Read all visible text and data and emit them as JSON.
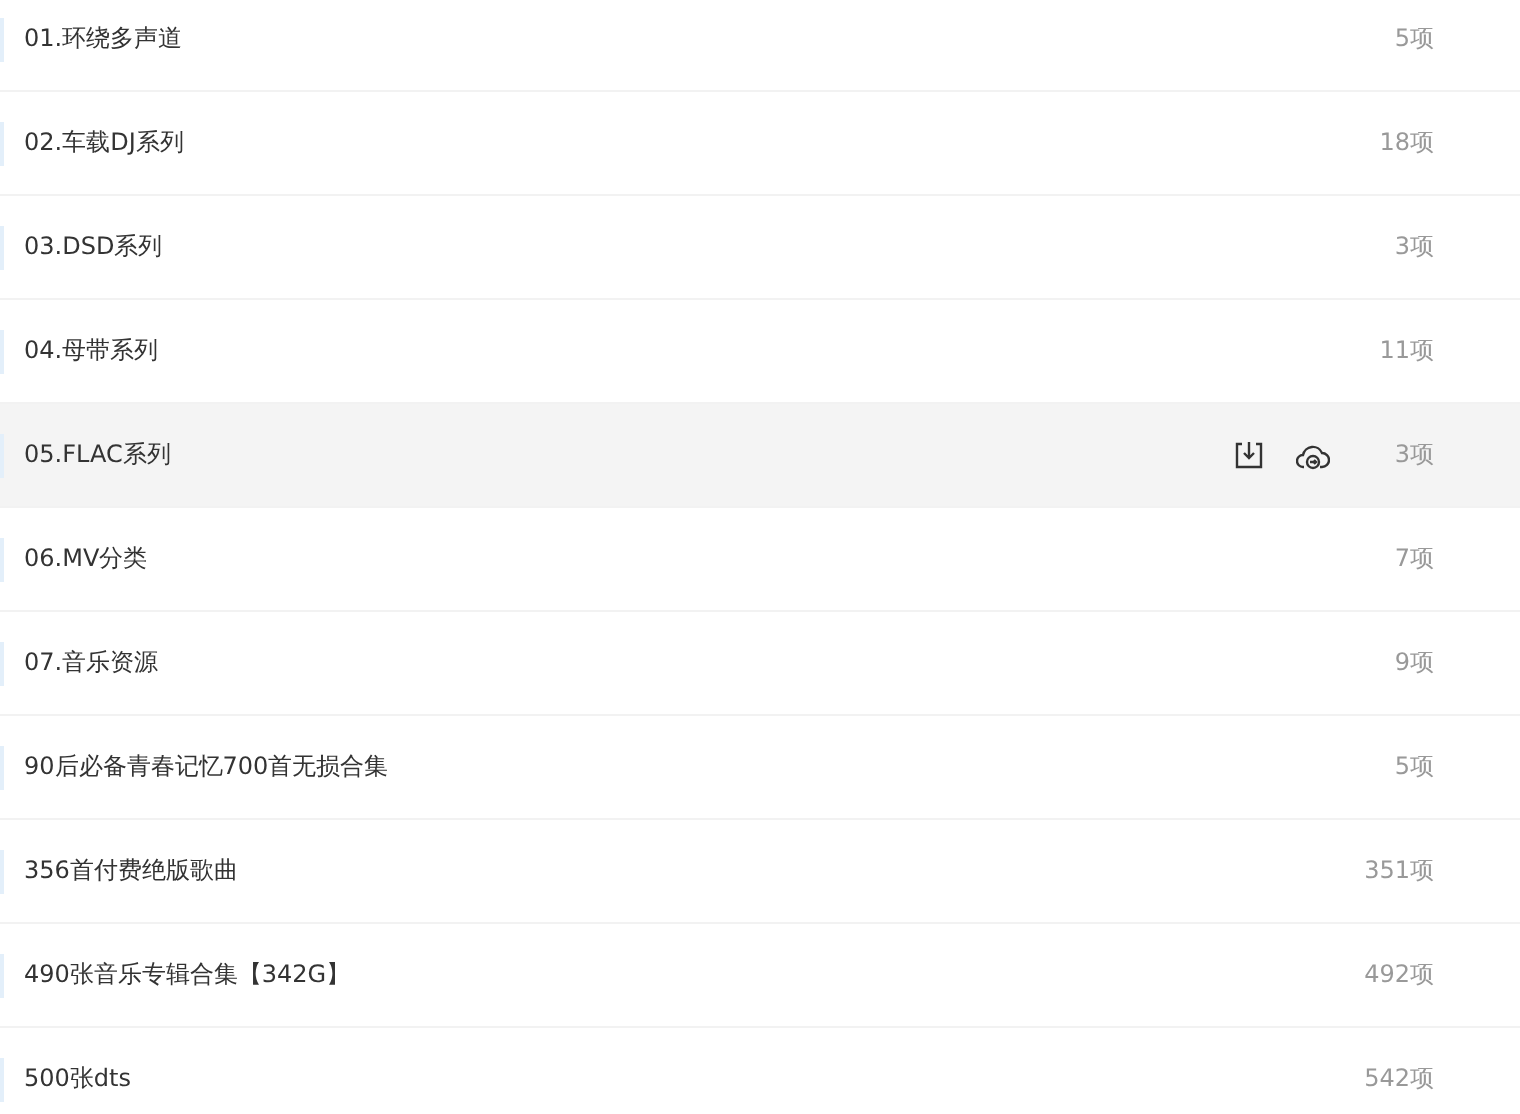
{
  "folders": [
    {
      "name": "01.环绕多声道",
      "count": "5项",
      "hovered": false
    },
    {
      "name": "02.车载DJ系列",
      "count": "18项",
      "hovered": false
    },
    {
      "name": "03.DSD系列",
      "count": "3项",
      "hovered": false
    },
    {
      "name": "04.母带系列",
      "count": "11项",
      "hovered": false
    },
    {
      "name": "05.FLAC系列",
      "count": "3项",
      "hovered": true
    },
    {
      "name": "06.MV分类",
      "count": "7项",
      "hovered": false
    },
    {
      "name": "07.音乐资源",
      "count": "9项",
      "hovered": false
    },
    {
      "name": "90后必备青春记忆700首无损合集",
      "count": "5项",
      "hovered": false
    },
    {
      "name": "356首付费绝版歌曲",
      "count": "351项",
      "hovered": false
    },
    {
      "name": "490张音乐专辑合集【342G】",
      "count": "492项",
      "hovered": false
    },
    {
      "name": "500张dts",
      "count": "542项",
      "hovered": false
    }
  ]
}
